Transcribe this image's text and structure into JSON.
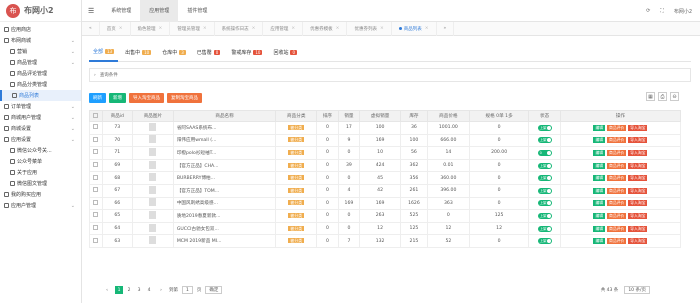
{
  "app": {
    "logo_letter": "布",
    "title": "布网小2"
  },
  "sidebar": {
    "items": [
      {
        "label": "应用商店",
        "sub": false,
        "arrow": false
      },
      {
        "label": "布网商城",
        "sub": false,
        "arrow": true
      },
      {
        "label": "营销",
        "sub": true,
        "arrow": true
      },
      {
        "label": "商品管理",
        "sub": true,
        "arrow": true
      },
      {
        "label": "商品评论管理",
        "sub": true,
        "arrow": false
      },
      {
        "label": "商品分类管理",
        "sub": true,
        "arrow": false
      },
      {
        "label": "商品列表",
        "sub": true,
        "arrow": false,
        "active": true
      },
      {
        "label": "订单管理",
        "sub": false,
        "arrow": true
      },
      {
        "label": "商城用户管理",
        "sub": false,
        "arrow": true
      },
      {
        "label": "商城设置",
        "sub": false,
        "arrow": true
      },
      {
        "label": "应用设置",
        "sub": false,
        "arrow": true
      },
      {
        "label": "微信公众号关...",
        "sub": true,
        "arrow": false
      },
      {
        "label": "公众号菜单",
        "sub": true,
        "arrow": false
      },
      {
        "label": "关于应用",
        "sub": true,
        "arrow": false
      },
      {
        "label": "微信图文管理",
        "sub": true,
        "arrow": false
      },
      {
        "label": "我的购买应用",
        "sub": false,
        "arrow": false
      },
      {
        "label": "应用户管理",
        "sub": false,
        "arrow": true
      }
    ]
  },
  "topnav": [
    "系统管理",
    "应用管理",
    "插件管理"
  ],
  "topnav_active": 1,
  "topright": {
    "refresh": "⟳",
    "full": "⛶",
    "user": "布网小2"
  },
  "tabs": [
    {
      "label": "首页"
    },
    {
      "label": "角色管理"
    },
    {
      "label": "管理员管理"
    },
    {
      "label": "系统操作日志"
    },
    {
      "label": "应用管理"
    },
    {
      "label": "优惠券模板"
    },
    {
      "label": "优惠券列表"
    },
    {
      "label": "商品列表",
      "on": true
    }
  ],
  "subtabs": [
    {
      "label": "全部",
      "n": "13"
    },
    {
      "label": "出售中",
      "n": "10"
    },
    {
      "label": "仓库中",
      "n": "3"
    },
    {
      "label": "已售罄",
      "n": "0"
    },
    {
      "label": "警戒库存",
      "n": "10"
    },
    {
      "label": "回收站",
      "n": "0"
    }
  ],
  "query": "查询条件",
  "buttons": [
    "刷新",
    "新增",
    "导入淘宝商品",
    "复制淘宝商品"
  ],
  "table": {
    "headers": [
      "商品id",
      "商品图片",
      "商品名称",
      "商品分类",
      "排序",
      "销量",
      "虚拟销量",
      "库存",
      "商品价格",
      "规格 0单 1多",
      "状态",
      "操作"
    ],
    "rows": [
      [
        "73",
        "省阿SAAS系统布...",
        "被分类",
        "0",
        "17",
        "100",
        "36",
        "1001.00",
        "0",
        "上架"
      ],
      [
        "70",
        "阳伟应用wmall (...",
        "被分类",
        "0",
        "9",
        "169",
        "100",
        "666.00",
        "0",
        "上架"
      ],
      [
        "71",
        "印橙polo衫短袖T...",
        "被分类",
        "0",
        "0",
        "10",
        "56",
        "14",
        "200.00",
        "0"
      ],
      [
        "69",
        "【官方正品】CHA...",
        "被分类",
        "0",
        "39",
        "424",
        "362",
        "0.01",
        "0",
        "上架"
      ],
      [
        "68",
        "BURBERRY博柏...",
        "被分类",
        "0",
        "0",
        "45",
        "356",
        "360.00",
        "0",
        "上架"
      ],
      [
        "67",
        "【官方正品】TOM...",
        "被分类",
        "0",
        "4",
        "42",
        "261",
        "396.00",
        "0",
        "上架"
      ],
      [
        "66",
        "中国风刺绣高级感...",
        "被分类",
        "0",
        "169",
        "169",
        "1626",
        "363",
        "0",
        "上架"
      ],
      [
        "65",
        "质地2019春夏新款...",
        "被分类",
        "0",
        "0",
        "263",
        "525",
        "0",
        "125",
        "上架"
      ],
      [
        "64",
        "GUCCI古驰女包双...",
        "被分类",
        "0",
        "0",
        "12",
        "125",
        "12",
        "12",
        "上架"
      ],
      [
        "63",
        "MCM 2019新品 MI...",
        "被分类",
        "0",
        "7",
        "132",
        "215",
        "52",
        "0",
        "上架"
      ]
    ]
  },
  "ops": [
    "编辑",
    "商品评价",
    "导入淘宝"
  ],
  "pager": {
    "pages": [
      "1",
      "2",
      "3",
      "4"
    ],
    "goto": "到第",
    "page": "1",
    "page_unit": "页",
    "confirm": "确定",
    "total": "共 43 条",
    "per": "10 条/页"
  }
}
